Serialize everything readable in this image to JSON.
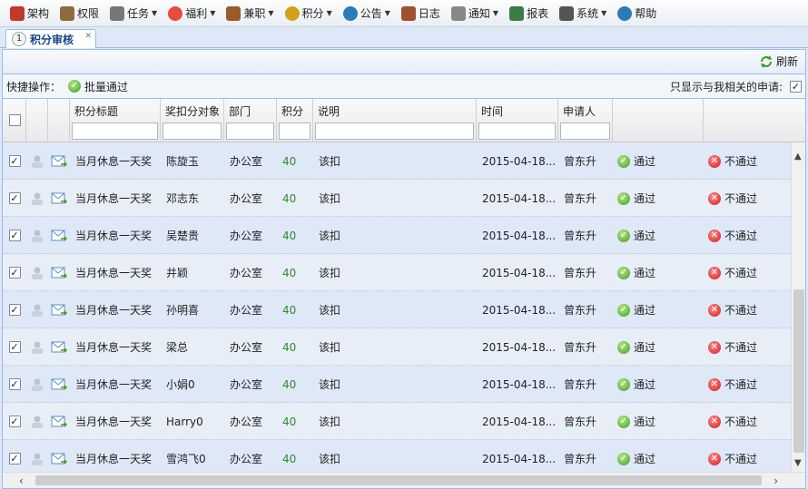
{
  "menu": [
    {
      "label": "架构",
      "icon": "org-chart-icon",
      "dropdown": false,
      "color": "#c0392b"
    },
    {
      "label": "权限",
      "icon": "user-key-icon",
      "dropdown": false,
      "color": "#8e6b3e"
    },
    {
      "label": "任务",
      "icon": "task-list-icon",
      "dropdown": true,
      "color": "#777777"
    },
    {
      "label": "福利",
      "icon": "heart-icon",
      "dropdown": true,
      "color": "#e74c3c"
    },
    {
      "label": "兼职",
      "icon": "briefcase-icon",
      "dropdown": true,
      "color": "#9b5a2a"
    },
    {
      "label": "积分",
      "icon": "coin-icon",
      "dropdown": true,
      "color": "#d4a017"
    },
    {
      "label": "公告",
      "icon": "info-icon",
      "dropdown": true,
      "color": "#2b7bb9"
    },
    {
      "label": "日志",
      "icon": "journal-icon",
      "dropdown": false,
      "color": "#a0522d"
    },
    {
      "label": "通知",
      "icon": "speaker-icon",
      "dropdown": true,
      "color": "#888888"
    },
    {
      "label": "报表",
      "icon": "report-chart-icon",
      "dropdown": false,
      "color": "#3a7d44"
    },
    {
      "label": "系统",
      "icon": "system-monitor-icon",
      "dropdown": true,
      "color": "#555555"
    },
    {
      "label": "帮助",
      "icon": "help-icon",
      "dropdown": false,
      "color": "#2b7bb9"
    }
  ],
  "tab": {
    "number": "1",
    "label": "积分审核"
  },
  "toolbar": {
    "refresh_label": "刷新"
  },
  "quickbar": {
    "label": "快捷操作：",
    "batch_label": "批量通过",
    "filter_label": "只显示与我相关的申请:",
    "filter_checked": "✓"
  },
  "columns": {
    "title": "积分标题",
    "target": "奖扣分对象",
    "dept": "部门",
    "points": "积分",
    "desc": "说明",
    "time": "时间",
    "applicant": "申请人"
  },
  "actions": {
    "approve": "通过",
    "reject": "不通过"
  },
  "rows": [
    {
      "checked": "✓",
      "title": "当月休息一天奖",
      "target": "陈旋玉",
      "dept": "办公室",
      "points": "40",
      "desc": "该扣",
      "time": "2015-04-18...",
      "applicant": "曾东升"
    },
    {
      "checked": "✓",
      "title": "当月休息一天奖",
      "target": "邓志东",
      "dept": "办公室",
      "points": "40",
      "desc": "该扣",
      "time": "2015-04-18...",
      "applicant": "曾东升"
    },
    {
      "checked": "✓",
      "title": "当月休息一天奖",
      "target": "吴楚贵",
      "dept": "办公室",
      "points": "40",
      "desc": "该扣",
      "time": "2015-04-18...",
      "applicant": "曾东升"
    },
    {
      "checked": "✓",
      "title": "当月休息一天奖",
      "target": "井颖",
      "dept": "办公室",
      "points": "40",
      "desc": "该扣",
      "time": "2015-04-18...",
      "applicant": "曾东升"
    },
    {
      "checked": "✓",
      "title": "当月休息一天奖",
      "target": "孙明喜",
      "dept": "办公室",
      "points": "40",
      "desc": "该扣",
      "time": "2015-04-18...",
      "applicant": "曾东升"
    },
    {
      "checked": "✓",
      "title": "当月休息一天奖",
      "target": "梁总",
      "dept": "办公室",
      "points": "40",
      "desc": "该扣",
      "time": "2015-04-18...",
      "applicant": "曾东升"
    },
    {
      "checked": "✓",
      "title": "当月休息一天奖",
      "target": "小娟0",
      "dept": "办公室",
      "points": "40",
      "desc": "该扣",
      "time": "2015-04-18...",
      "applicant": "曾东升"
    },
    {
      "checked": "✓",
      "title": "当月休息一天奖",
      "target": "Harry0",
      "dept": "办公室",
      "points": "40",
      "desc": "该扣",
      "time": "2015-04-18...",
      "applicant": "曾东升"
    },
    {
      "checked": "✓",
      "title": "当月休息一天奖",
      "target": "雪鸿飞0",
      "dept": "办公室",
      "points": "40",
      "desc": "该扣",
      "time": "2015-04-18...",
      "applicant": "曾东升"
    }
  ],
  "colors": {
    "accent": "#99bbe8",
    "points": "#2e8b2e",
    "approve": "#3a9d23",
    "reject": "#d11a1a"
  }
}
